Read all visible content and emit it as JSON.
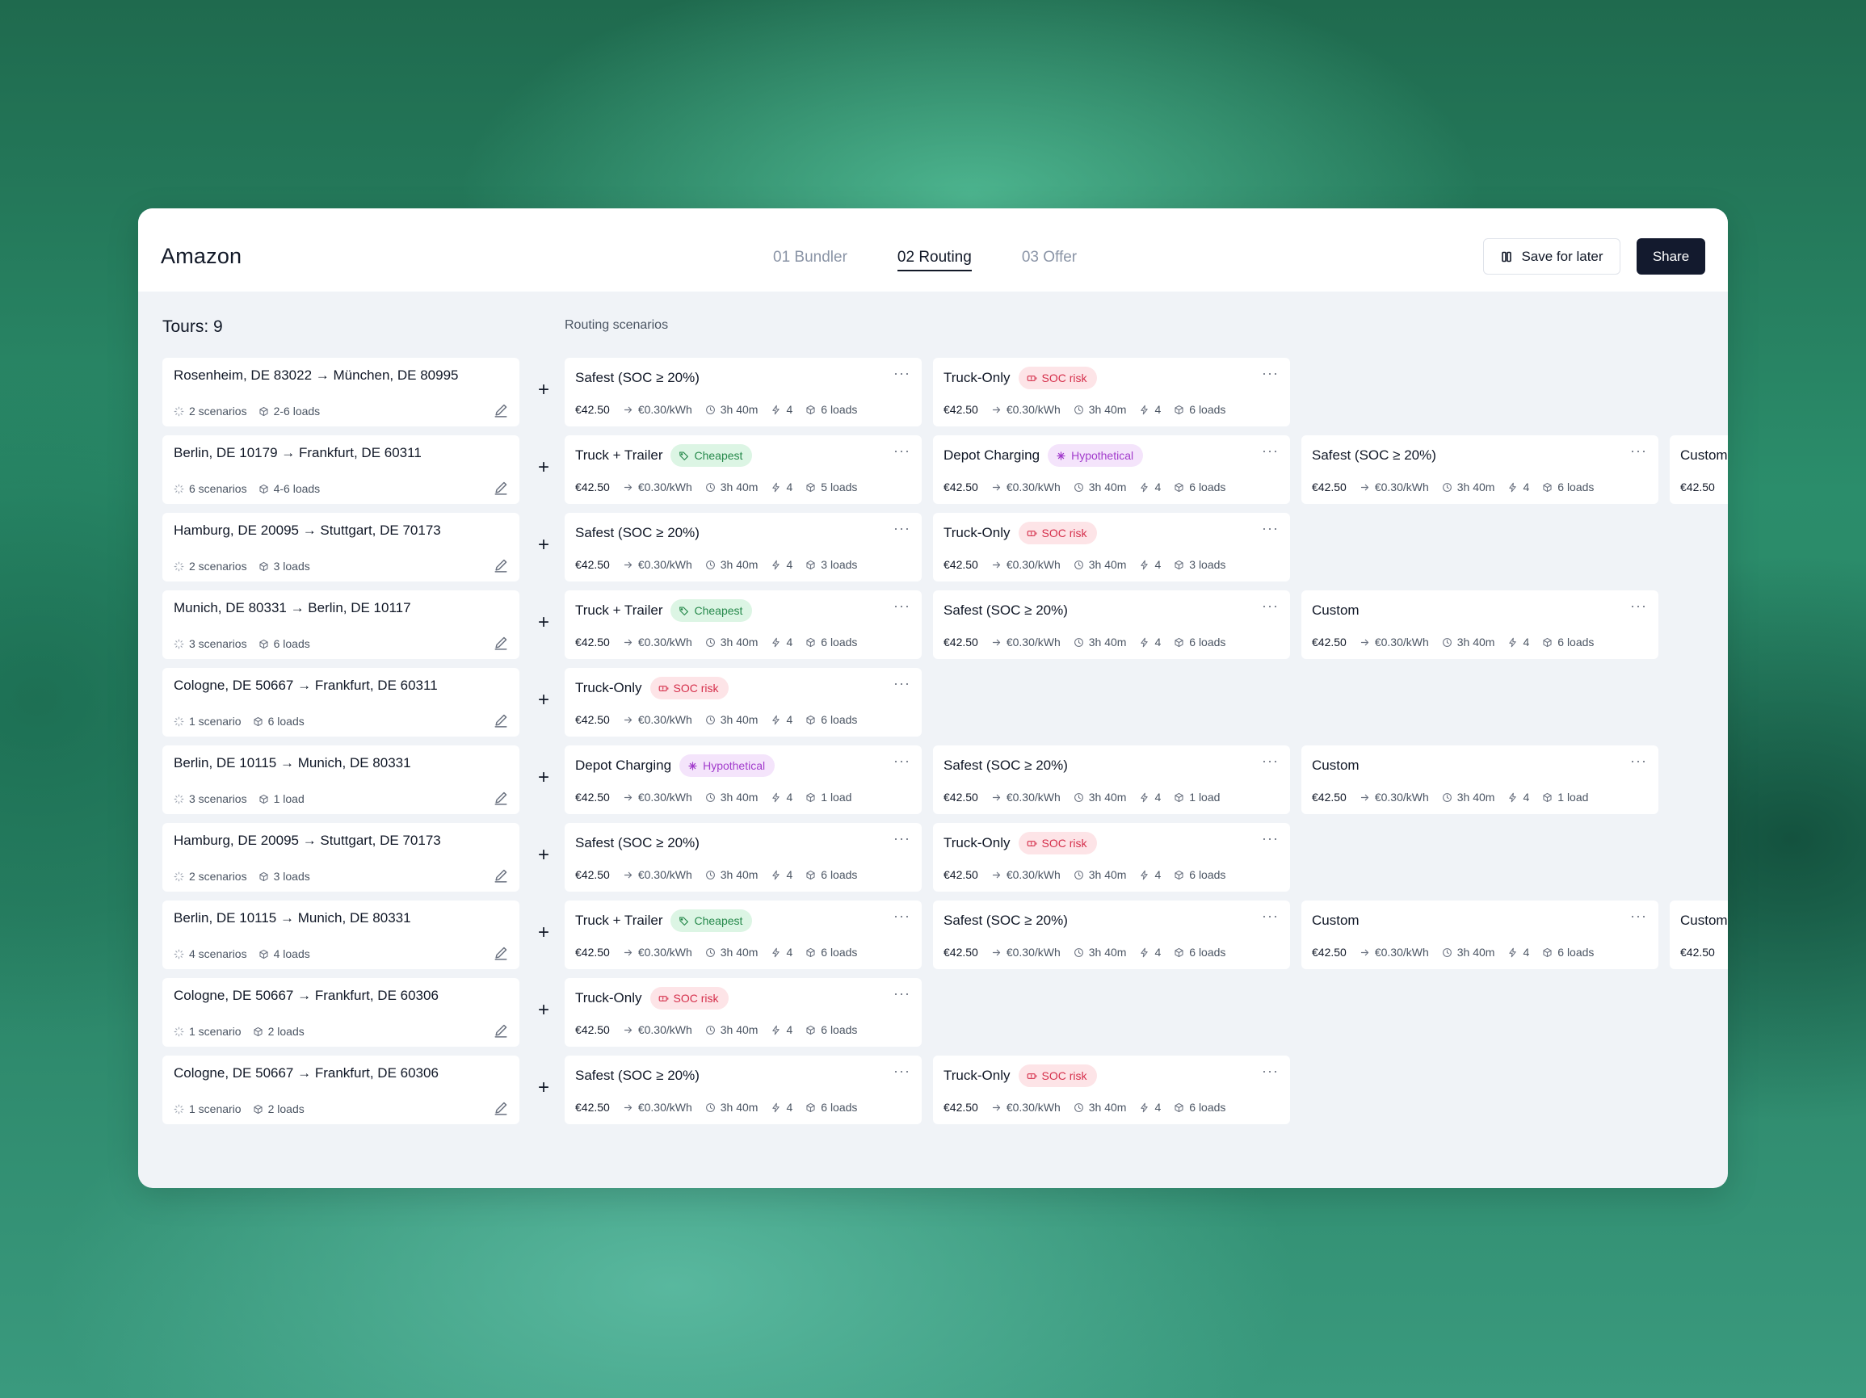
{
  "header": {
    "brand": "Amazon",
    "steps": [
      "01 Bundler",
      "02 Routing",
      "03 Offer"
    ],
    "active_step": 1,
    "save_label": "Save for later",
    "share_label": "Share"
  },
  "tours_title": "Tours: 9",
  "scenarios_title": "Routing scenarios",
  "colors": {
    "soc_risk": "#d52f4b",
    "cheapest": "#26894b",
    "hypothetical": "#a23ccc",
    "primary_button": "#131a2e"
  },
  "icons": {
    "scenarios": "spinner-icon",
    "loads": "box-icon",
    "edit": "pencil-icon",
    "rate": "arrow-right-icon",
    "duration": "clock-icon",
    "charges": "bolt-icon",
    "more": "more-icon",
    "soc_risk": "battery-warning-icon",
    "cheapest": "tag-icon",
    "hypothetical": "sparkle-icon",
    "save": "columns-icon"
  },
  "tours": [
    {
      "route": "Rosenheim, DE 83022 → München, DE 80995",
      "scenarios": "2 scenarios",
      "loads": "2-6 loads",
      "options": [
        {
          "name": "Safest (SOC ≥ 20%)",
          "badge": "",
          "badge_type": "",
          "price": "€42.50",
          "rate": "€0.30/kWh",
          "duration": "3h 40m",
          "charges": "4",
          "loads": "6 loads"
        },
        {
          "name": "Truck-Only",
          "badge": "SOC risk",
          "badge_type": "soc",
          "price": "€42.50",
          "rate": "€0.30/kWh",
          "duration": "3h 40m",
          "charges": "4",
          "loads": "6 loads"
        }
      ]
    },
    {
      "route": "Berlin, DE 10179 → Frankfurt, DE 60311",
      "scenarios": "6 scenarios",
      "loads": "4-6 loads",
      "options": [
        {
          "name": "Truck + Trailer",
          "badge": "Cheapest",
          "badge_type": "cheap",
          "price": "€42.50",
          "rate": "€0.30/kWh",
          "duration": "3h 40m",
          "charges": "4",
          "loads": "5 loads"
        },
        {
          "name": "Depot Charging",
          "badge": "Hypothetical",
          "badge_type": "hypo",
          "price": "€42.50",
          "rate": "€0.30/kWh",
          "duration": "3h 40m",
          "charges": "4",
          "loads": "6 loads"
        },
        {
          "name": "Safest (SOC ≥ 20%)",
          "badge": "",
          "badge_type": "",
          "price": "€42.50",
          "rate": "€0.30/kWh",
          "duration": "3h 40m",
          "charges": "4",
          "loads": "6 loads"
        },
        {
          "name": "Custom",
          "badge": "",
          "badge_type": "",
          "price": "€42.50",
          "rate": "",
          "duration": "",
          "charges": "",
          "loads": ""
        }
      ]
    },
    {
      "route": "Hamburg, DE 20095 → Stuttgart, DE 70173",
      "scenarios": "2 scenarios",
      "loads": "3 loads",
      "options": [
        {
          "name": "Safest (SOC ≥ 20%)",
          "badge": "",
          "badge_type": "",
          "price": "€42.50",
          "rate": "€0.30/kWh",
          "duration": "3h 40m",
          "charges": "4",
          "loads": "3 loads"
        },
        {
          "name": "Truck-Only",
          "badge": "SOC risk",
          "badge_type": "soc",
          "price": "€42.50",
          "rate": "€0.30/kWh",
          "duration": "3h 40m",
          "charges": "4",
          "loads": "3 loads"
        }
      ]
    },
    {
      "route": "Munich, DE 80331 → Berlin, DE 10117",
      "scenarios": "3 scenarios",
      "loads": "6 loads",
      "options": [
        {
          "name": "Truck + Trailer",
          "badge": "Cheapest",
          "badge_type": "cheap",
          "price": "€42.50",
          "rate": "€0.30/kWh",
          "duration": "3h 40m",
          "charges": "4",
          "loads": "6 loads"
        },
        {
          "name": "Safest (SOC ≥ 20%)",
          "badge": "",
          "badge_type": "",
          "price": "€42.50",
          "rate": "€0.30/kWh",
          "duration": "3h 40m",
          "charges": "4",
          "loads": "6 loads"
        },
        {
          "name": "Custom",
          "badge": "",
          "badge_type": "",
          "price": "€42.50",
          "rate": "€0.30/kWh",
          "duration": "3h 40m",
          "charges": "4",
          "loads": "6 loads"
        }
      ]
    },
    {
      "route": "Cologne, DE 50667 → Frankfurt, DE 60311",
      "scenarios": "1 scenario",
      "loads": "6 loads",
      "options": [
        {
          "name": "Truck-Only",
          "badge": "SOC risk",
          "badge_type": "soc",
          "price": "€42.50",
          "rate": "€0.30/kWh",
          "duration": "3h 40m",
          "charges": "4",
          "loads": "6 loads"
        }
      ]
    },
    {
      "route": "Berlin, DE 10115 → Munich, DE 80331",
      "scenarios": "3 scenarios",
      "loads": "1 load",
      "options": [
        {
          "name": "Depot Charging",
          "badge": "Hypothetical",
          "badge_type": "hypo",
          "price": "€42.50",
          "rate": "€0.30/kWh",
          "duration": "3h 40m",
          "charges": "4",
          "loads": "1 load"
        },
        {
          "name": "Safest (SOC ≥ 20%)",
          "badge": "",
          "badge_type": "",
          "price": "€42.50",
          "rate": "€0.30/kWh",
          "duration": "3h 40m",
          "charges": "4",
          "loads": "1 load"
        },
        {
          "name": "Custom",
          "badge": "",
          "badge_type": "",
          "price": "€42.50",
          "rate": "€0.30/kWh",
          "duration": "3h 40m",
          "charges": "4",
          "loads": "1 load"
        }
      ]
    },
    {
      "route": "Hamburg, DE 20095 → Stuttgart, DE 70173",
      "scenarios": "2 scenarios",
      "loads": "3 loads",
      "options": [
        {
          "name": "Safest (SOC ≥ 20%)",
          "badge": "",
          "badge_type": "",
          "price": "€42.50",
          "rate": "€0.30/kWh",
          "duration": "3h 40m",
          "charges": "4",
          "loads": "6 loads"
        },
        {
          "name": "Truck-Only",
          "badge": "SOC risk",
          "badge_type": "soc",
          "price": "€42.50",
          "rate": "€0.30/kWh",
          "duration": "3h 40m",
          "charges": "4",
          "loads": "6 loads"
        }
      ]
    },
    {
      "route": "Berlin, DE 10115 → Munich, DE 80331",
      "scenarios": "4 scenarios",
      "loads": "4 loads",
      "options": [
        {
          "name": "Truck + Trailer",
          "badge": "Cheapest",
          "badge_type": "cheap",
          "price": "€42.50",
          "rate": "€0.30/kWh",
          "duration": "3h 40m",
          "charges": "4",
          "loads": "6 loads"
        },
        {
          "name": "Safest (SOC ≥ 20%)",
          "badge": "",
          "badge_type": "",
          "price": "€42.50",
          "rate": "€0.30/kWh",
          "duration": "3h 40m",
          "charges": "4",
          "loads": "6 loads"
        },
        {
          "name": "Custom",
          "badge": "",
          "badge_type": "",
          "price": "€42.50",
          "rate": "€0.30/kWh",
          "duration": "3h 40m",
          "charges": "4",
          "loads": "6 loads"
        },
        {
          "name": "Custom",
          "badge": "",
          "badge_type": "",
          "price": "€42.50",
          "rate": "",
          "duration": "",
          "charges": "",
          "loads": ""
        }
      ]
    },
    {
      "route": "Cologne, DE 50667 → Frankfurt, DE 60306",
      "scenarios": "1 scenario",
      "loads": "2 loads",
      "options": [
        {
          "name": "Truck-Only",
          "badge": "SOC risk",
          "badge_type": "soc",
          "price": "€42.50",
          "rate": "€0.30/kWh",
          "duration": "3h 40m",
          "charges": "4",
          "loads": "6 loads"
        }
      ]
    },
    {
      "route": "Cologne, DE 50667 → Frankfurt, DE 60306",
      "scenarios": "1 scenario",
      "loads": "2 loads",
      "options": [
        {
          "name": "Safest (SOC ≥ 20%)",
          "badge": "",
          "badge_type": "",
          "price": "€42.50",
          "rate": "€0.30/kWh",
          "duration": "3h 40m",
          "charges": "4",
          "loads": "6 loads"
        },
        {
          "name": "Truck-Only",
          "badge": "SOC risk",
          "badge_type": "soc",
          "price": "€42.50",
          "rate": "€0.30/kWh",
          "duration": "3h 40m",
          "charges": "4",
          "loads": "6 loads"
        }
      ]
    }
  ]
}
